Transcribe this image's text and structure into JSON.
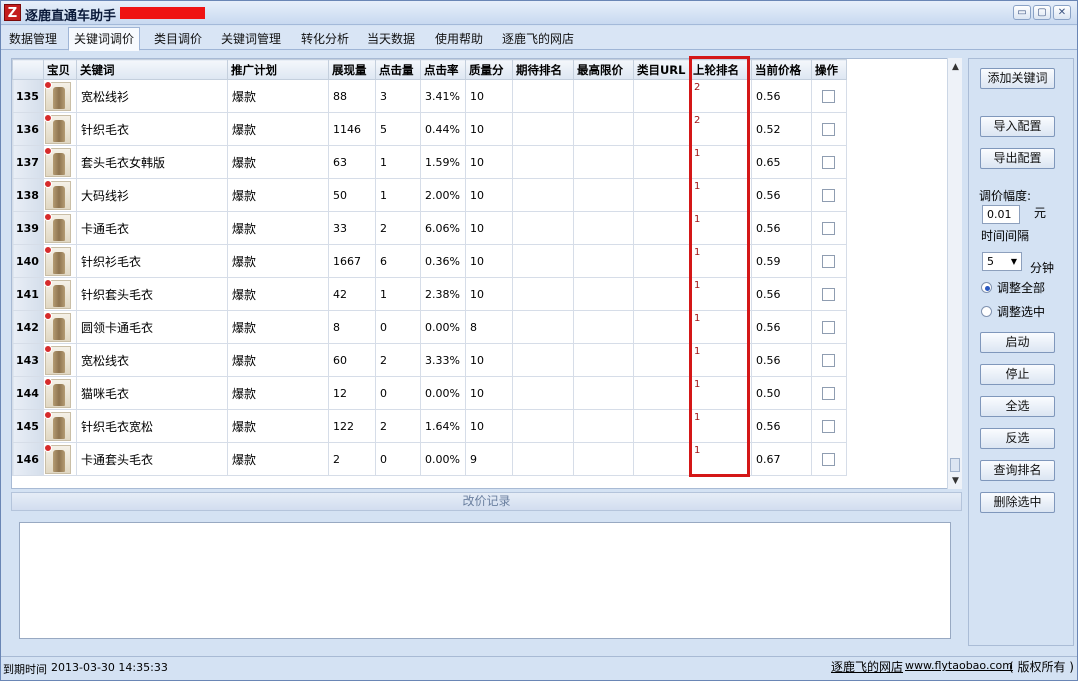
{
  "app": {
    "logo_glyph": "Z",
    "title": "逐鹿直通车助手",
    "window_buttons": {
      "minimize": "▭",
      "maximize": "▢",
      "close": "✕"
    }
  },
  "tabs": [
    "数据管理",
    "关键词调价",
    "类目调价",
    "关键词管理",
    "转化分析",
    "当天数据",
    "使用帮助",
    "逐鹿飞的网店"
  ],
  "active_tab": "关键词调价",
  "grid": {
    "columns": [
      "",
      "宝贝",
      "关键词",
      "推广计划",
      "展现量",
      "点击量",
      "点击率",
      "质量分",
      "期待排名",
      "最高限价",
      "类目URL",
      "上轮排名",
      "当前价格",
      "操作"
    ],
    "rows": [
      {
        "id": "135",
        "keyword": "宽松线衫",
        "plan": "爆款",
        "impressions": "88",
        "clicks": "3",
        "ctr": "3.41%",
        "quality": "10",
        "expected": "",
        "maxprice": "",
        "caturl": "",
        "lastrank": "2",
        "price": "0.56"
      },
      {
        "id": "136",
        "keyword": "针织毛衣",
        "plan": "爆款",
        "impressions": "1146",
        "clicks": "5",
        "ctr": "0.44%",
        "quality": "10",
        "expected": "",
        "maxprice": "",
        "caturl": "",
        "lastrank": "2",
        "price": "0.52"
      },
      {
        "id": "137",
        "keyword": "套头毛衣女韩版",
        "plan": "爆款",
        "impressions": "63",
        "clicks": "1",
        "ctr": "1.59%",
        "quality": "10",
        "expected": "",
        "maxprice": "",
        "caturl": "",
        "lastrank": "1",
        "price": "0.65"
      },
      {
        "id": "138",
        "keyword": "大码线衫",
        "plan": "爆款",
        "impressions": "50",
        "clicks": "1",
        "ctr": "2.00%",
        "quality": "10",
        "expected": "",
        "maxprice": "",
        "caturl": "",
        "lastrank": "1",
        "price": "0.56"
      },
      {
        "id": "139",
        "keyword": "卡通毛衣",
        "plan": "爆款",
        "impressions": "33",
        "clicks": "2",
        "ctr": "6.06%",
        "quality": "10",
        "expected": "",
        "maxprice": "",
        "caturl": "",
        "lastrank": "1",
        "price": "0.56"
      },
      {
        "id": "140",
        "keyword": "针织衫毛衣",
        "plan": "爆款",
        "impressions": "1667",
        "clicks": "6",
        "ctr": "0.36%",
        "quality": "10",
        "expected": "",
        "maxprice": "",
        "caturl": "",
        "lastrank": "1",
        "price": "0.59"
      },
      {
        "id": "141",
        "keyword": "针织套头毛衣",
        "plan": "爆款",
        "impressions": "42",
        "clicks": "1",
        "ctr": "2.38%",
        "quality": "10",
        "expected": "",
        "maxprice": "",
        "caturl": "",
        "lastrank": "1",
        "price": "0.56"
      },
      {
        "id": "142",
        "keyword": "圆领卡通毛衣",
        "plan": "爆款",
        "impressions": "8",
        "clicks": "0",
        "ctr": "0.00%",
        "quality": "8",
        "expected": "",
        "maxprice": "",
        "caturl": "",
        "lastrank": "1",
        "price": "0.56"
      },
      {
        "id": "143",
        "keyword": "宽松线衣",
        "plan": "爆款",
        "impressions": "60",
        "clicks": "2",
        "ctr": "3.33%",
        "quality": "10",
        "expected": "",
        "maxprice": "",
        "caturl": "",
        "lastrank": "1",
        "price": "0.56"
      },
      {
        "id": "144",
        "keyword": "猫咪毛衣",
        "plan": "爆款",
        "impressions": "12",
        "clicks": "0",
        "ctr": "0.00%",
        "quality": "10",
        "expected": "",
        "maxprice": "",
        "caturl": "",
        "lastrank": "1",
        "price": "0.50"
      },
      {
        "id": "145",
        "keyword": "针织毛衣宽松",
        "plan": "爆款",
        "impressions": "122",
        "clicks": "2",
        "ctr": "1.64%",
        "quality": "10",
        "expected": "",
        "maxprice": "",
        "caturl": "",
        "lastrank": "1",
        "price": "0.56"
      },
      {
        "id": "146",
        "keyword": "卡通套头毛衣",
        "plan": "爆款",
        "impressions": "2",
        "clicks": "0",
        "ctr": "0.00%",
        "quality": "9",
        "expected": "",
        "maxprice": "",
        "caturl": "",
        "lastrank": "1",
        "price": "0.67"
      }
    ]
  },
  "log": {
    "title": "改价记录",
    "content": ""
  },
  "side": {
    "add_keyword": "添加关键词",
    "import_config": "导入配置",
    "export_config": "导出配置",
    "range_label": "调价幅度:",
    "range_value": "0.01",
    "range_unit": "元",
    "interval_label": "时间间隔",
    "interval_value": "5",
    "interval_unit": "分钟",
    "radio_all": "调整全部",
    "radio_selected": "调整选中",
    "radio_selected_value": "all",
    "start": "启动",
    "stop": "停止",
    "select_all": "全选",
    "invert": "反选",
    "query_rank": "查询排名",
    "delete_selected": "删除选中"
  },
  "status": {
    "expiry_label": "到期时间",
    "expiry_value": "2013-03-30 14:35:33",
    "shop_link": "逐鹿飞的网店",
    "site_url": "www.flytaobao.com",
    "copyright": "( 版权所有 )"
  },
  "colors": {
    "highlight": "#d41717",
    "rank_text": "#a01818",
    "redaction": "#ef1313"
  }
}
